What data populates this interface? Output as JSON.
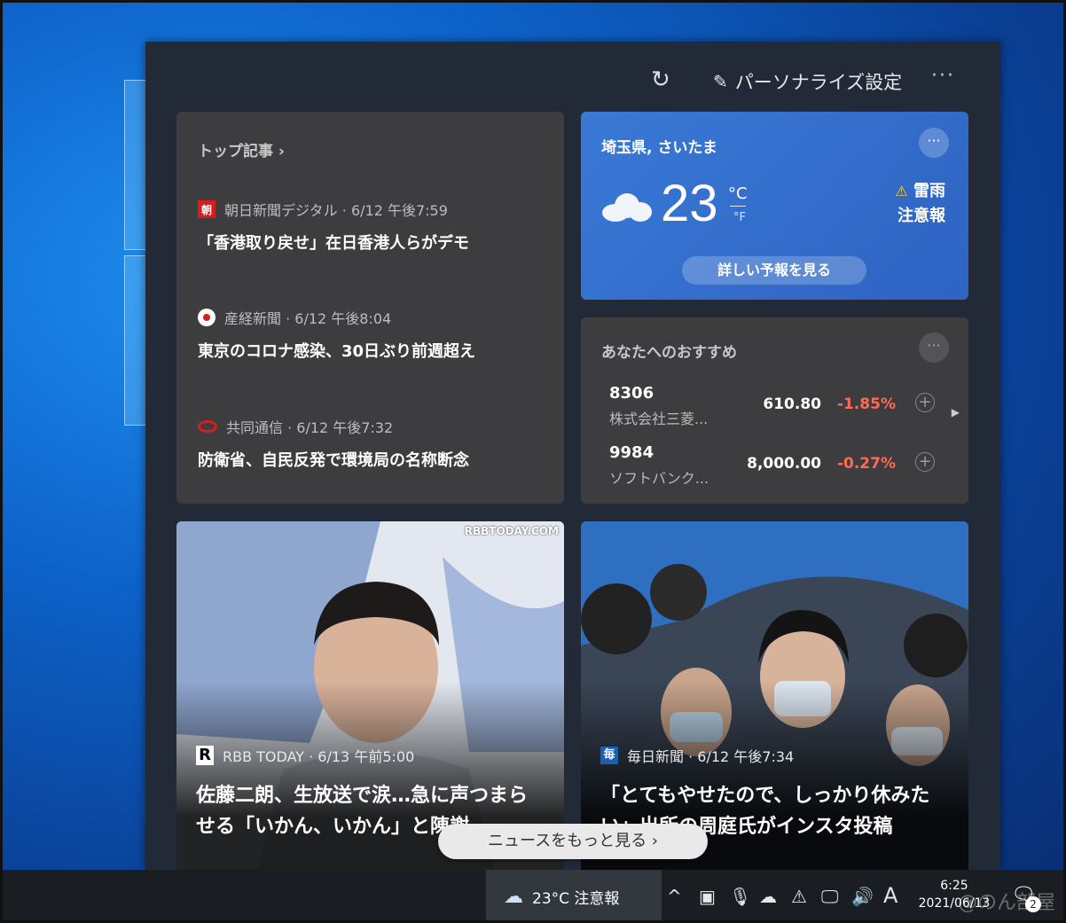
{
  "toolbar": {
    "refresh_icon": "↻",
    "personalize_label": "パーソナライズ設定",
    "more_icon": "···"
  },
  "top_stories": {
    "title": "トップ記事 ›",
    "items": [
      {
        "logo": "朝",
        "source": "朝日新聞デジタル · 6/12 午後7:59",
        "headline": "「香港取り戻せ」在日香港人らがデモ"
      },
      {
        "source": "産経新聞 · 6/12 午後8:04",
        "headline": "東京のコロナ感染、30日ぶり前週超え"
      },
      {
        "source": "共同通信 · 6/12 午後7:32",
        "headline": "防衛省、自民反発で環境局の名称断念"
      }
    ]
  },
  "weather": {
    "location": "埼玉県, さいたま",
    "more_icon": "···",
    "temperature": "23",
    "unit_c": "°C",
    "unit_f": "°F",
    "alert_icon": "⚠",
    "alert_line1": "雷雨",
    "alert_line2": "注意報",
    "forecast_button": "詳しい予報を見る"
  },
  "stocks": {
    "title": "あなたへのおすすめ",
    "more_icon": "···",
    "rows": [
      {
        "symbol": "8306",
        "name": "株式会社三菱...",
        "price": "610.80",
        "change": "-1.85%"
      },
      {
        "symbol": "9984",
        "name": "ソフトバンク...",
        "price": "8,000.00",
        "change": "-0.27%"
      }
    ],
    "add_icon": "+",
    "next_icon": "▶"
  },
  "image_cards": [
    {
      "watermark": "RBBTODAY.COM",
      "logo": "R",
      "source": "RBB TODAY · 6/13 午前5:00",
      "headline": "佐藤二朗、生放送で涙…急に声つまらせる「いかん、いかん」と陳謝"
    },
    {
      "logo": "毎",
      "source": "毎日新聞 · 6/12 午後7:34",
      "headline": "「とてもやせたので、しっかり休みたい」出所の周庭氏がインスタ投稿"
    }
  ],
  "more_news_button": "ニュースをもっと見る ›",
  "taskbar": {
    "weather_label": "23°C 注意報",
    "chevron": "^",
    "ime": "A",
    "time": "6:25",
    "date": "2021/06/13",
    "notification_count": "2"
  },
  "watermark": "@のん部屋"
}
